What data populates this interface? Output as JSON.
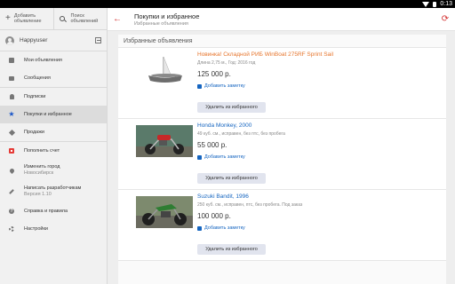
{
  "status": {
    "time": "0:13"
  },
  "sidebar": {
    "add_label_1": "Добавить",
    "add_label_2": "объявление",
    "search_label_1": "Поиск",
    "search_label_2": "объявлений",
    "username": "Happyuser",
    "items": [
      {
        "label": "Мои объявления"
      },
      {
        "label": "Сообщения"
      },
      {
        "label": "Подписки"
      },
      {
        "label": "Покупки и избранное"
      },
      {
        "label": "Продажи"
      },
      {
        "label": "Пополнить счет"
      },
      {
        "label": "Изменить город",
        "sub": "Новосибирск"
      },
      {
        "label": "Написать разработчикам",
        "sub": "Версия 1.10"
      },
      {
        "label": "Справка и правила"
      },
      {
        "label": "Настройки"
      }
    ]
  },
  "header": {
    "title": "Покупки и избранное",
    "subtitle": "Избранные объявления"
  },
  "content": {
    "section_title": "Избранные объявления",
    "add_note_label": "Добавить заметку",
    "remove_label": "Удалить из избранного",
    "listings": [
      {
        "title": "Новинка! Складной РИБ WinBoat 275RF Sprint Sail",
        "desc": "Длина 2,75 м., Год: 2016 год",
        "price": "125 000 р."
      },
      {
        "title": "Honda Monkey, 2000",
        "desc": "49 куб. см., исправен, без птс, без пробега",
        "price": "55 000 р."
      },
      {
        "title": "Suzuki Bandit, 1996",
        "desc": "250 куб. см., исправен, птс, без пробега. Под заказ",
        "price": "100 000 р."
      }
    ]
  }
}
